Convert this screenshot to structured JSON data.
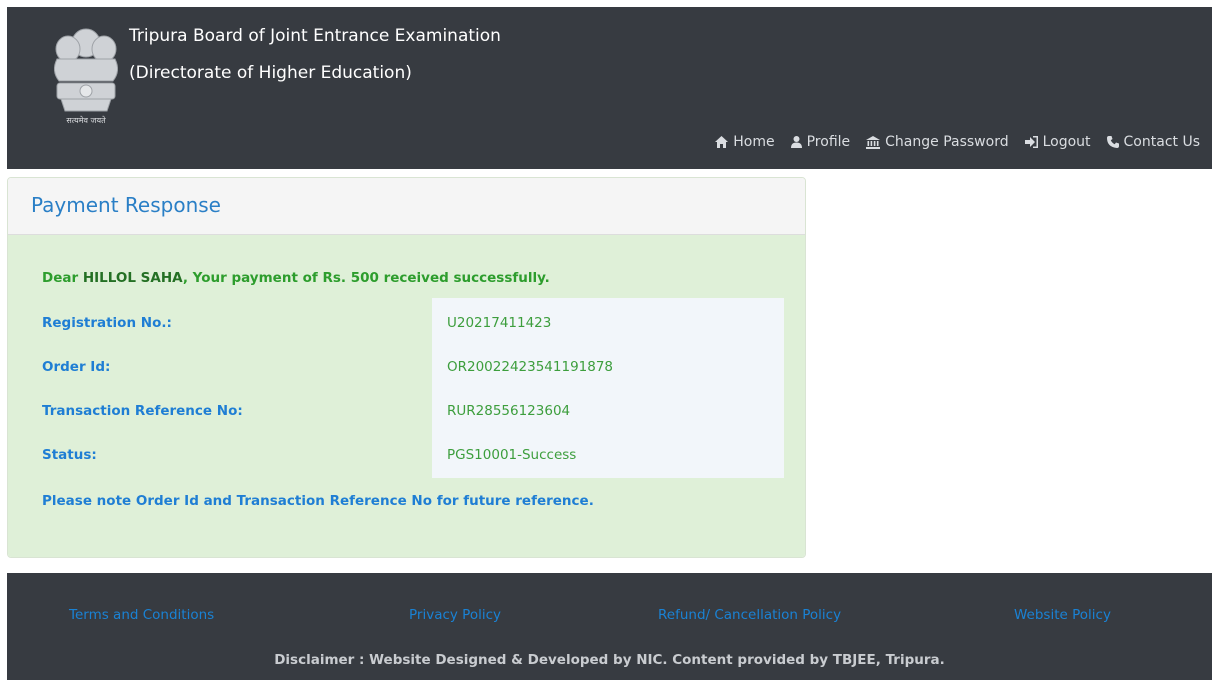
{
  "header": {
    "title": "Tripura Board of Joint Entrance Examination",
    "subtitle": "(Directorate of Higher Education)",
    "emblem_caption": "सत्यमेव जयते",
    "nav": [
      {
        "label": "Home",
        "icon": "home-icon"
      },
      {
        "label": "Profile",
        "icon": "user-icon"
      },
      {
        "label": "Change Password",
        "icon": "bank-icon"
      },
      {
        "label": "Logout",
        "icon": "logout-icon"
      },
      {
        "label": "Contact Us",
        "icon": "phone-icon"
      }
    ]
  },
  "panel": {
    "title": "Payment Response",
    "greeting_prefix": "Dear ",
    "name": "HILLOL SAHA",
    "greeting_suffix": ", Your payment of Rs. 500 received successfully.",
    "rows": [
      {
        "label": "Registration No.:",
        "value": "U20217411423"
      },
      {
        "label": "Order Id:",
        "value": "OR20022423541191878"
      },
      {
        "label": "Transaction Reference No:",
        "value": "RUR28556123604"
      },
      {
        "label": "Status:",
        "value": "PGS10001-Success"
      }
    ],
    "note": "Please note Order Id and Transaction Reference No for future reference."
  },
  "footer": {
    "links": [
      "Terms and Conditions",
      "Privacy Policy",
      "Refund/ Cancellation Policy",
      "Website Policy"
    ],
    "disclaimer": "Disclaimer : Website Designed & Developed by NIC. Content provided by TBJEE, Tripura."
  },
  "colors": {
    "header_bg": "#373b41",
    "panel_title": "#2a7fc6",
    "success_green": "#2d9d2d",
    "label_blue": "#1f7ed4",
    "panel_body_bg": "#dff0d8"
  }
}
